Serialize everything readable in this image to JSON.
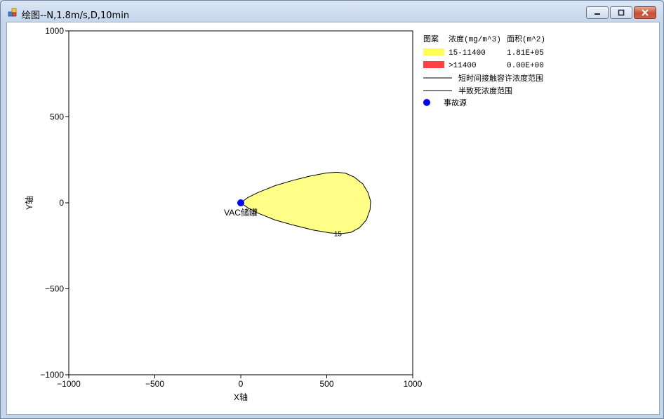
{
  "window": {
    "title": "绘图--N,1.8m/s,D,10min"
  },
  "legend": {
    "header": {
      "col1": "图案",
      "col2": "浓度(mg/m^3)",
      "col3": "面积(m^2)"
    },
    "rows": [
      {
        "label": "15-11400",
        "area": "1.81E+05",
        "color": "#ffff55"
      },
      {
        "label": ">11400",
        "area": "0.00E+00",
        "color": "#ff4040"
      }
    ],
    "lines": [
      {
        "label": "短时间接触容许浓度范围"
      },
      {
        "label": "半致死浓度范围"
      }
    ],
    "source": {
      "label": "事故源",
      "color": "#0000ff"
    }
  },
  "chart_data": {
    "type": "area",
    "xlabel": "X轴",
    "ylabel": "Y轴",
    "xlim": [
      -1000,
      1000
    ],
    "ylim": [
      -1000,
      1000
    ],
    "xticks": [
      -1000,
      -500,
      0,
      500,
      1000
    ],
    "yticks": [
      1000,
      500,
      0,
      -500,
      -1000
    ],
    "xtick_labels": [
      "−1000",
      "−500",
      "0",
      "500",
      "1000"
    ],
    "ytick_labels": [
      "1000",
      "500",
      "0",
      "−500",
      "−1000"
    ],
    "grid": false,
    "legend_position": "right",
    "plume": {
      "color": "#ffff88",
      "label": "15",
      "label_x": 565,
      "label_y": -178,
      "outline": [
        [
          0,
          0
        ],
        [
          40,
          30
        ],
        [
          100,
          60
        ],
        [
          200,
          100
        ],
        [
          300,
          130
        ],
        [
          400,
          155
        ],
        [
          500,
          174
        ],
        [
          560,
          178
        ],
        [
          610,
          172
        ],
        [
          660,
          150
        ],
        [
          710,
          110
        ],
        [
          740,
          60
        ],
        [
          755,
          10
        ],
        [
          752,
          -40
        ],
        [
          730,
          -100
        ],
        [
          690,
          -145
        ],
        [
          640,
          -172
        ],
        [
          580,
          -180
        ],
        [
          520,
          -175
        ],
        [
          420,
          -158
        ],
        [
          300,
          -128
        ],
        [
          200,
          -100
        ],
        [
          100,
          -60
        ],
        [
          40,
          -28
        ],
        [
          0,
          0
        ]
      ]
    },
    "source": {
      "x": 0,
      "y": 0,
      "label": "VAC储罐"
    }
  }
}
